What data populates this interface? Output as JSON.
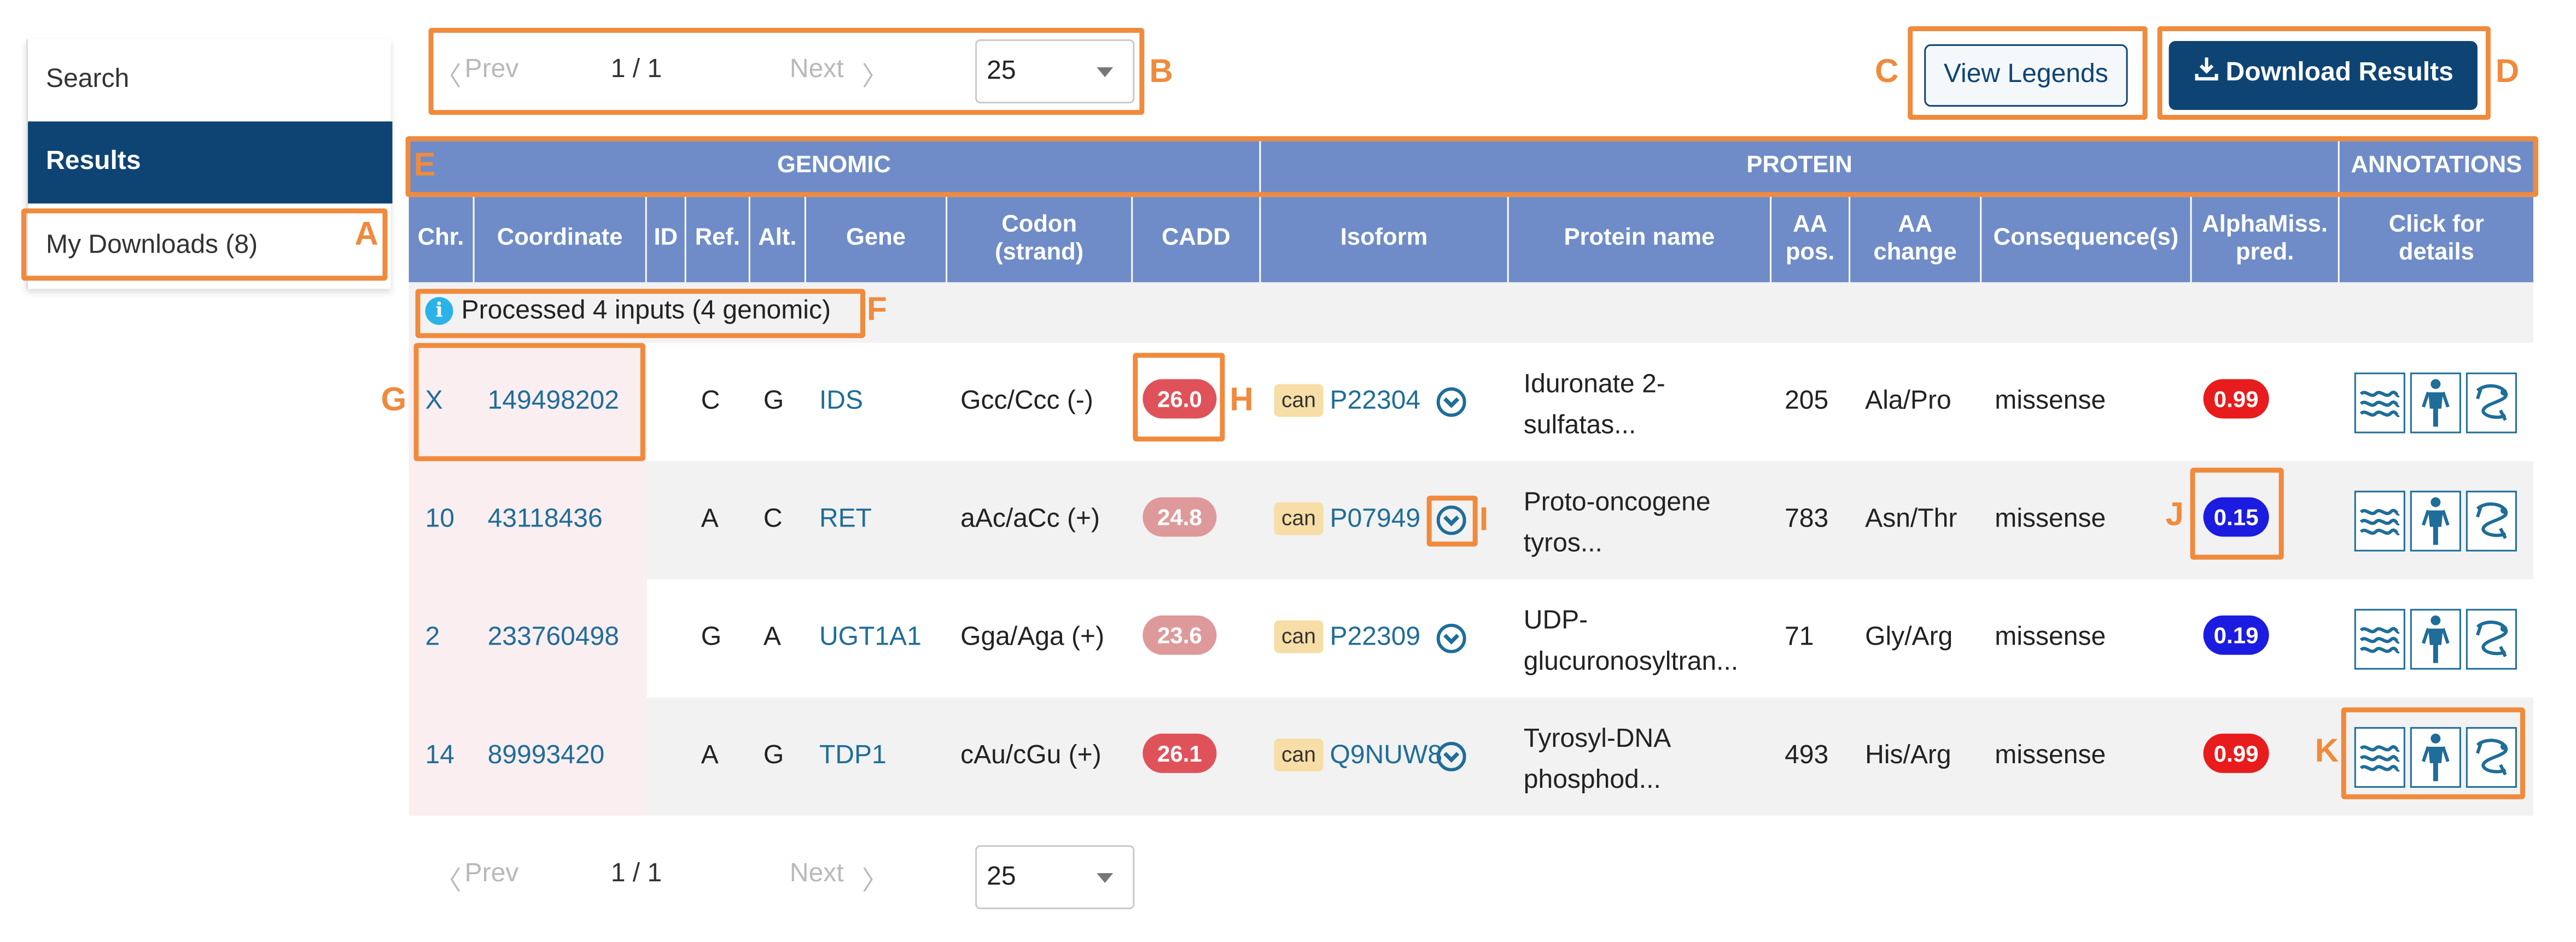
{
  "sidebar": {
    "items": [
      {
        "label": "Search"
      },
      {
        "label": "Results"
      },
      {
        "label": "My Downloads (8)"
      }
    ]
  },
  "pagination": {
    "prev": "Prev",
    "next": "Next",
    "page": "1 / 1",
    "per_page": "25"
  },
  "buttons": {
    "view_legends": "View Legends",
    "download": "Download Results"
  },
  "annotations": {
    "A": "A",
    "B": "B",
    "C": "C",
    "D": "D",
    "E": "E",
    "F": "F",
    "G": "G",
    "H": "H",
    "I": "I",
    "J": "J",
    "K": "K"
  },
  "table": {
    "groups": {
      "genomic": "GENOMIC",
      "protein": "PROTEIN",
      "annotations": "ANNOTATIONS"
    },
    "headers": {
      "chr": "Chr.",
      "coordinate": "Coordinate",
      "id": "ID",
      "ref": "Ref.",
      "alt": "Alt.",
      "gene": "Gene",
      "codon_l1": "Codon",
      "codon_l2": "(strand)",
      "cadd": "CADD",
      "isoform": "Isoform",
      "protein_name": "Protein name",
      "aa_pos_l1": "AA",
      "aa_pos_l2": "pos.",
      "aa_change_l1": "AA",
      "aa_change_l2": "change",
      "consequence": "Consequence(s)",
      "alphamiss_l1": "AlphaMiss.",
      "alphamiss_l2": "pred.",
      "details_l1": "Click for",
      "details_l2": "details"
    },
    "info": "Processed 4 inputs (4 genomic)",
    "rows": [
      {
        "chr": "X",
        "coordinate": "149498202",
        "ref": "C",
        "alt": "G",
        "gene": "IDS",
        "codon": "Gcc/Ccc (-)",
        "cadd": "26.0",
        "can": "can",
        "isoform": "P22304",
        "protein_l1": "Iduronate 2-",
        "protein_l2": "sulfatas...",
        "aa_pos": "205",
        "aa_change": "Ala/Pro",
        "consequence": "missense",
        "alphamiss": "0.99"
      },
      {
        "chr": "10",
        "coordinate": "43118436",
        "ref": "A",
        "alt": "C",
        "gene": "RET",
        "codon": "aAc/aCc (+)",
        "cadd": "24.8",
        "can": "can",
        "isoform": "P07949",
        "protein_l1": "Proto-oncogene",
        "protein_l2": "tyros...",
        "aa_pos": "783",
        "aa_change": "Asn/Thr",
        "consequence": "missense",
        "alphamiss": "0.15"
      },
      {
        "chr": "2",
        "coordinate": "233760498",
        "ref": "G",
        "alt": "A",
        "gene": "UGT1A1",
        "codon": "Gga/Aga (+)",
        "cadd": "23.6",
        "can": "can",
        "isoform": "P22309",
        "protein_l1": "UDP-",
        "protein_l2": "glucuronosyltran...",
        "aa_pos": "71",
        "aa_change": "Gly/Arg",
        "consequence": "missense",
        "alphamiss": "0.19"
      },
      {
        "chr": "14",
        "coordinate": "89993420",
        "ref": "A",
        "alt": "G",
        "gene": "TDP1",
        "codon": "cAu/cGu (+)",
        "cadd": "26.1",
        "can": "can",
        "isoform": "Q9NUW8",
        "protein_l1": "Tyrosyl-DNA",
        "protein_l2": "phosphod...",
        "aa_pos": "493",
        "aa_change": "His/Arg",
        "consequence": "missense",
        "alphamiss": "0.99"
      }
    ]
  },
  "colors": {
    "primary": "#0e4474",
    "header": "#6f8cc8",
    "annotation": "#f08a3c",
    "cadd_strong": "#e0525a",
    "cadd_soft": "#de9a9a",
    "pathogenic": "#e81c1c",
    "benign": "#1c1ce0",
    "link": "#1f6d99"
  },
  "icons": [
    "info-icon",
    "download-icon",
    "chevron-left-icon",
    "chevron-right-icon",
    "chevron-down-circle-icon",
    "protein-structure-icon",
    "human-body-icon",
    "alphafold-icon"
  ]
}
